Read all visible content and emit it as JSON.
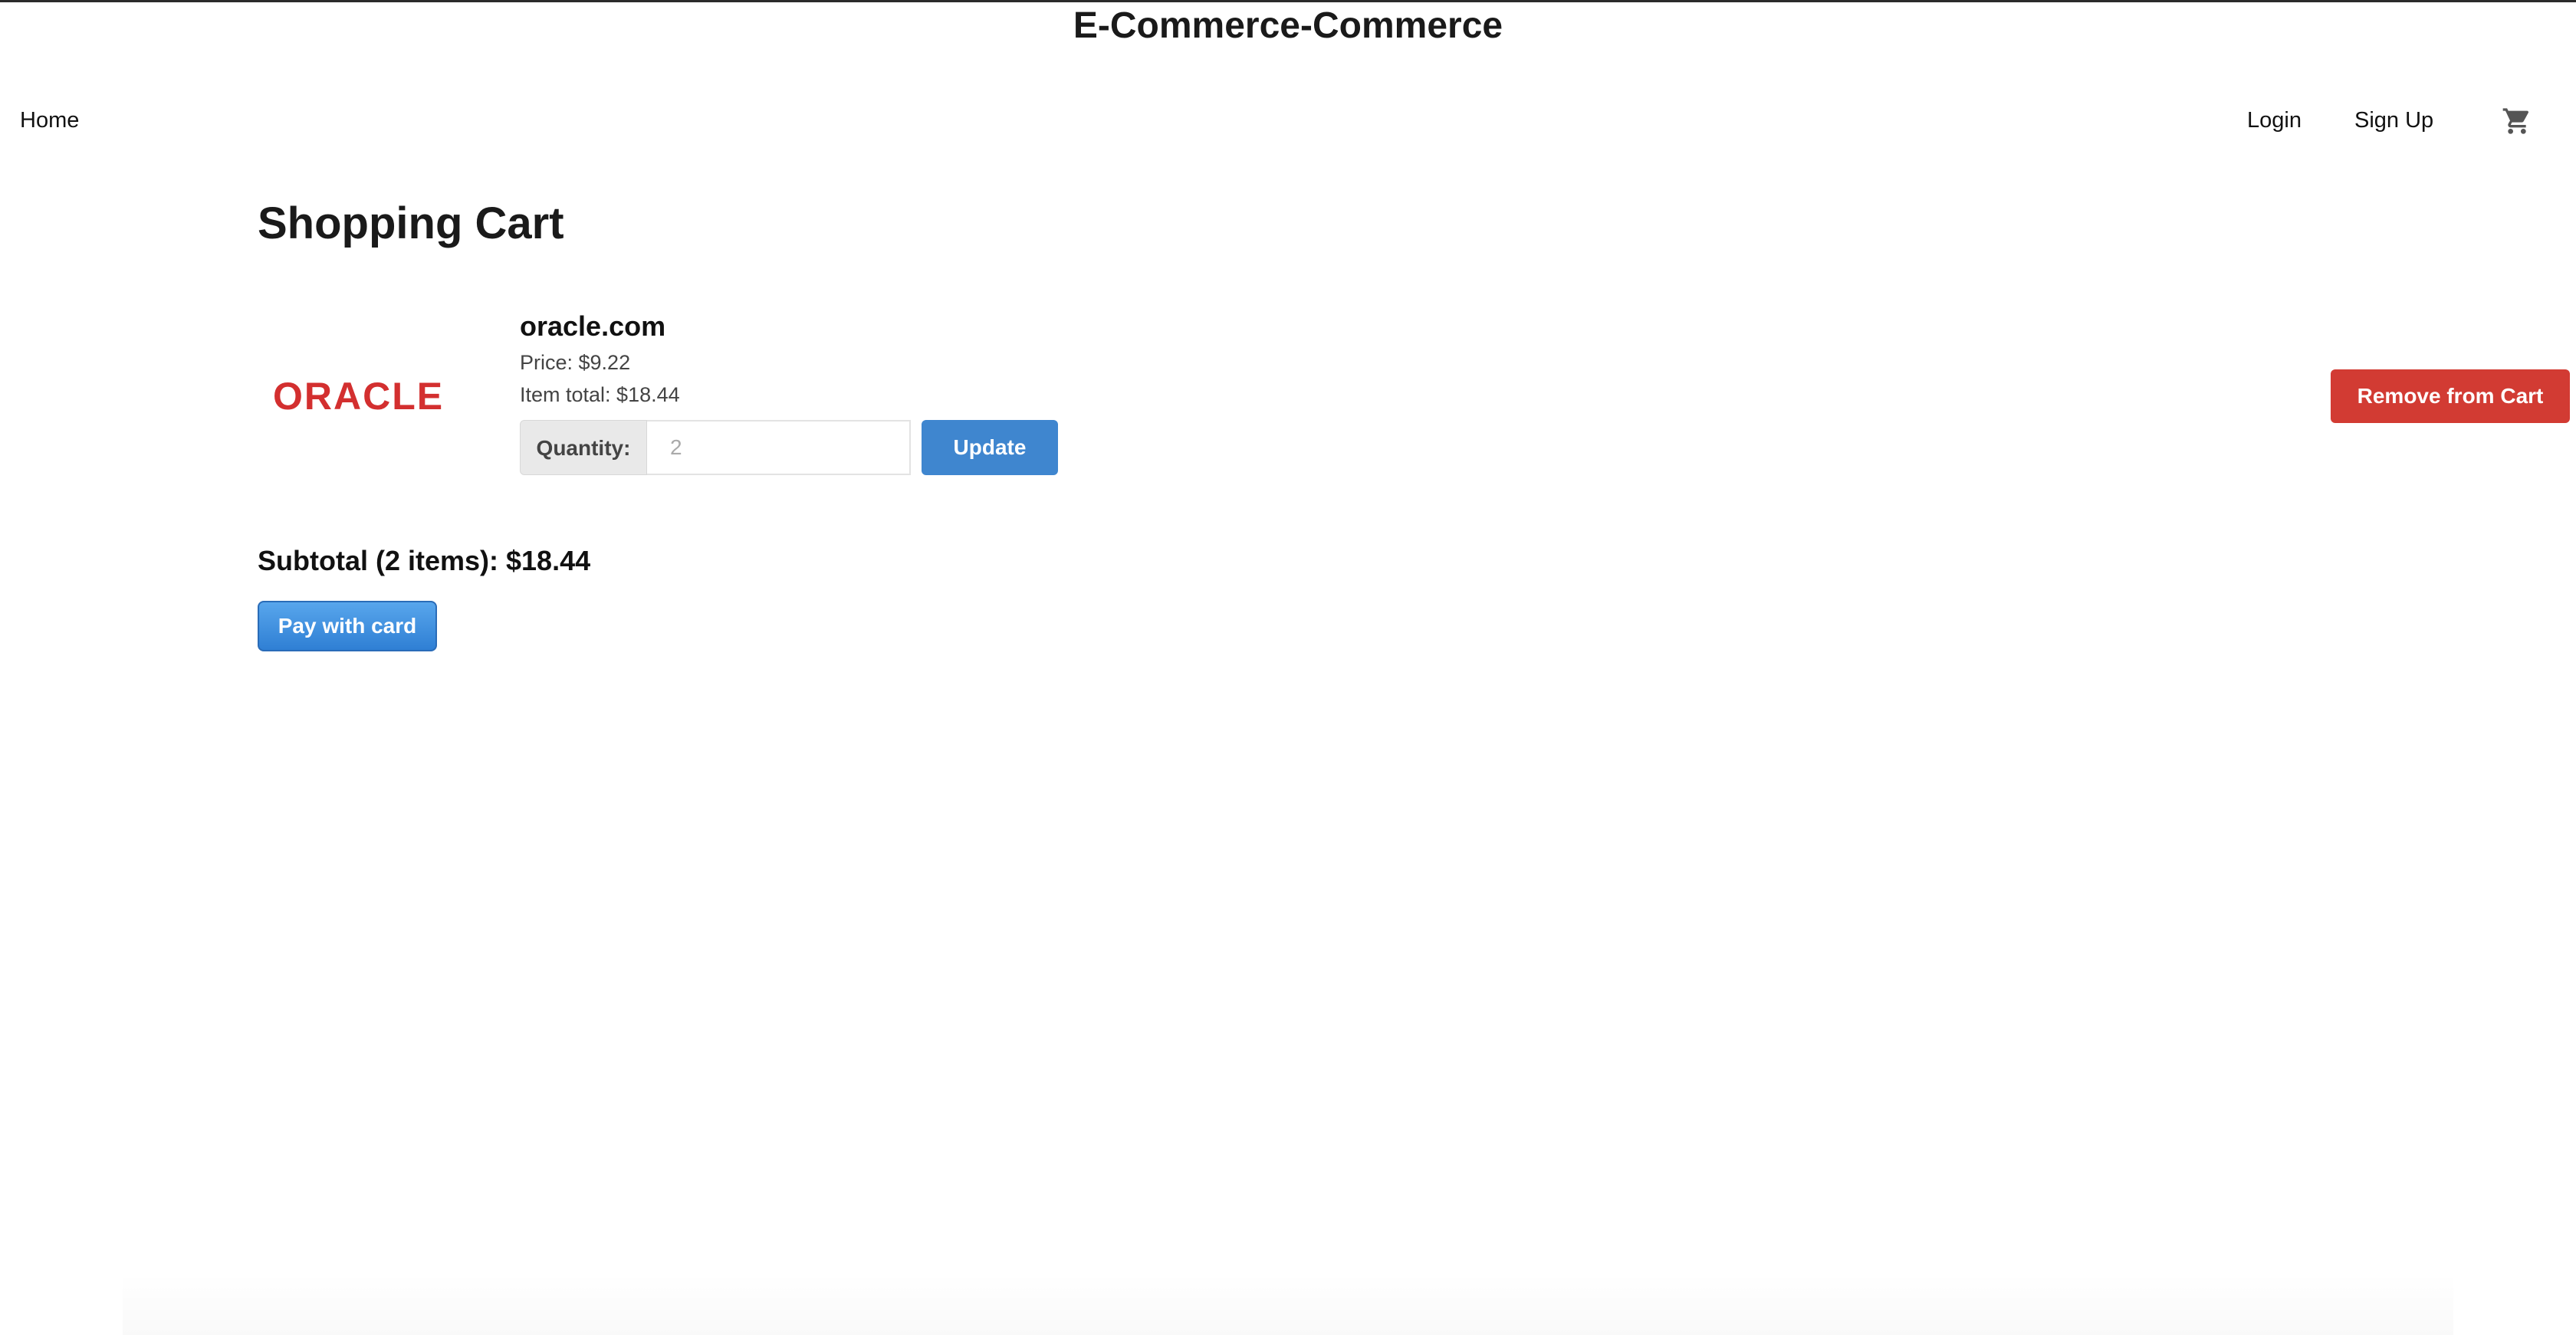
{
  "site": {
    "title": "E-Commerce-Commerce"
  },
  "nav": {
    "home_label": "Home",
    "login_label": "Login",
    "signup_label": "Sign Up",
    "cart_icon": "shopping-cart-icon"
  },
  "page": {
    "title": "Shopping Cart"
  },
  "cart": {
    "items": [
      {
        "name": "oracle.com",
        "image_icon": "oracle-logo",
        "image_text": "ORACLE",
        "price_text": "Price: $9.22",
        "item_total_text": "Item total: $18.44",
        "quantity_label": "Quantity:",
        "quantity_value": "2",
        "update_label": "Update",
        "remove_label": "Remove from Cart"
      }
    ],
    "subtotal_text": "Subtotal (2 items): $18.44",
    "pay_label": "Pay with card"
  },
  "colors": {
    "update_button": "#3f86cf",
    "remove_button": "#d23b33",
    "pay_button": "#2f7fd4",
    "oracle_red": "#d32f2f"
  }
}
